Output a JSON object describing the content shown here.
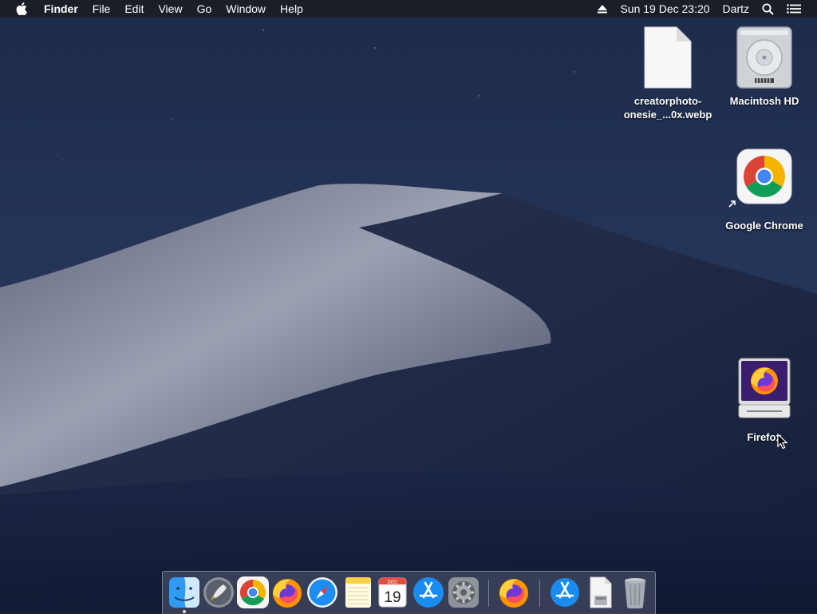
{
  "menubar": {
    "app_name": "Finder",
    "menus": [
      "File",
      "Edit",
      "View",
      "Go",
      "Window",
      "Help"
    ],
    "clock": "Sun 19 Dec  23:20",
    "user": "Dartz"
  },
  "desktop": {
    "file_label_line1": "creatorphoto-",
    "file_label_line2": "onesie_...0x.webp",
    "disk_label": "Macintosh HD",
    "chrome_label": "Google Chrome",
    "firefox_label": "Firefox"
  },
  "dock": {
    "calendar_month": "DEC",
    "calendar_day": "19",
    "items": [
      "finder-icon",
      "launchpad-icon",
      "chrome-icon",
      "firefox-icon",
      "safari-icon",
      "notes-icon",
      "calendar-icon",
      "app-store-icon",
      "system-preferences-icon",
      "firefox-icon",
      "app-store-icon",
      "downloads-stack-icon",
      "trash-icon"
    ]
  },
  "colors": {
    "sky_top": "#1c2a4a",
    "sky_bottom": "#121d36",
    "dune_light": "#8c93a6",
    "chrome_red": "#db4437",
    "chrome_green": "#0f9d58",
    "chrome_yellow": "#f4b400",
    "chrome_blue": "#4285f4"
  }
}
